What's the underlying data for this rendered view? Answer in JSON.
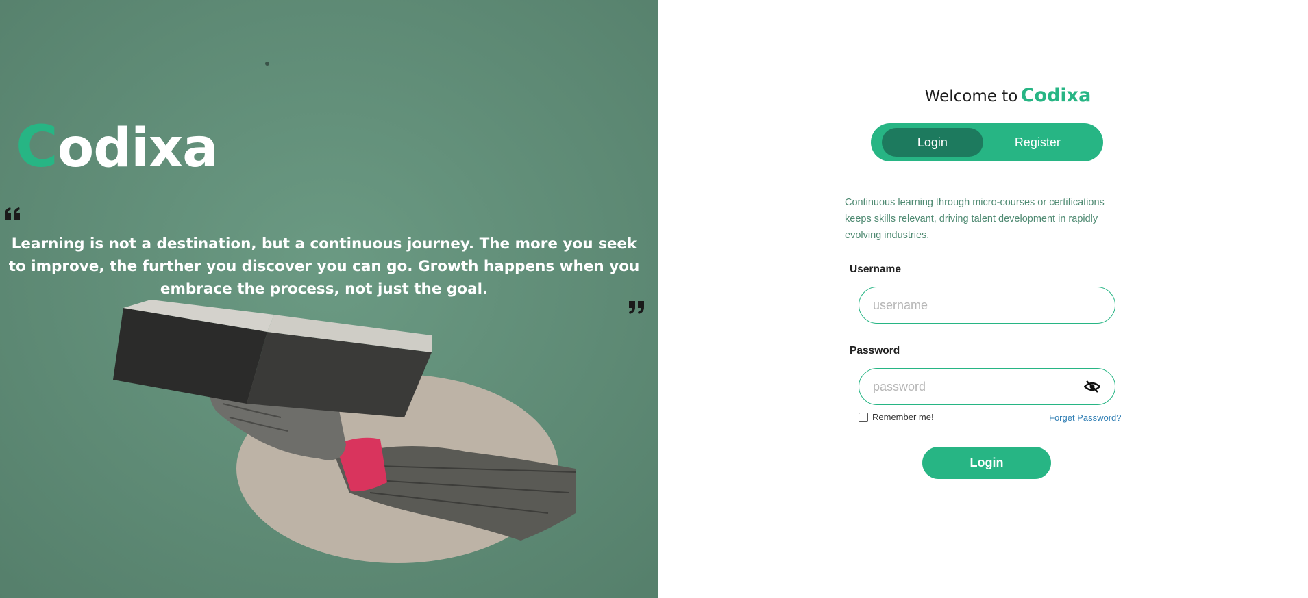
{
  "brand": {
    "first_letter": "C",
    "rest": "odixa"
  },
  "hero": {
    "quote": "Learning is not a destination, but a continuous journey. The more you seek to improve, the further you discover you can go. Growth happens when you embrace the process, not just the goal."
  },
  "auth": {
    "welcome_lead": "Welcome to",
    "welcome_name": "Codixa",
    "tabs": [
      {
        "label": "Login",
        "active": true
      },
      {
        "label": "Register",
        "active": false
      }
    ],
    "blurb": "Continuous learning through micro-courses or certifications keeps skills relevant, driving talent development in rapidly evolving industries.",
    "username_label": "Username",
    "username_placeholder": "username",
    "password_label": "Password",
    "password_placeholder": "password",
    "remember_label": "Remember me!",
    "forgot_label": "Forget Password?",
    "submit_label": "Login"
  },
  "colors": {
    "accent": "#27b584",
    "accent_dark": "#1d7a5e",
    "hero_bg": "#5f8f78",
    "link": "#2e7db3"
  }
}
